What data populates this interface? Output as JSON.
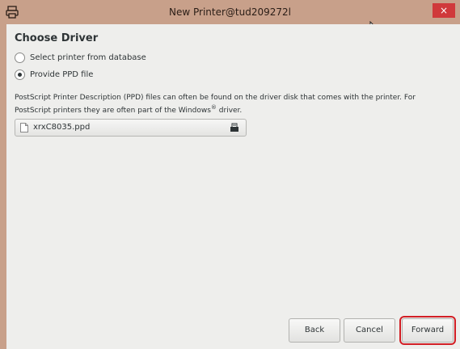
{
  "window": {
    "title": "New Printer@tud209272l",
    "close_glyph": "×"
  },
  "content": {
    "heading": "Choose Driver",
    "options": [
      {
        "label": "Select printer from database",
        "checked": false
      },
      {
        "label": "Provide PPD file",
        "checked": true
      }
    ],
    "description_part1": "PostScript Printer Description (PPD) files can often be found on the driver disk that comes with the printer. For PostScript printers they are often part of the Windows",
    "description_sup": "®",
    "description_part2": " driver.",
    "file_chooser": {
      "file_name": "xrxC8035.ppd",
      "file_icon": "document-icon",
      "open_icon": "open-folder-icon"
    }
  },
  "buttons": {
    "back": "Back",
    "cancel": "Cancel",
    "forward": "Forward"
  },
  "colors": {
    "titlebar": "#c8a08a",
    "close": "#d0393b",
    "highlight": "#d21f25"
  }
}
